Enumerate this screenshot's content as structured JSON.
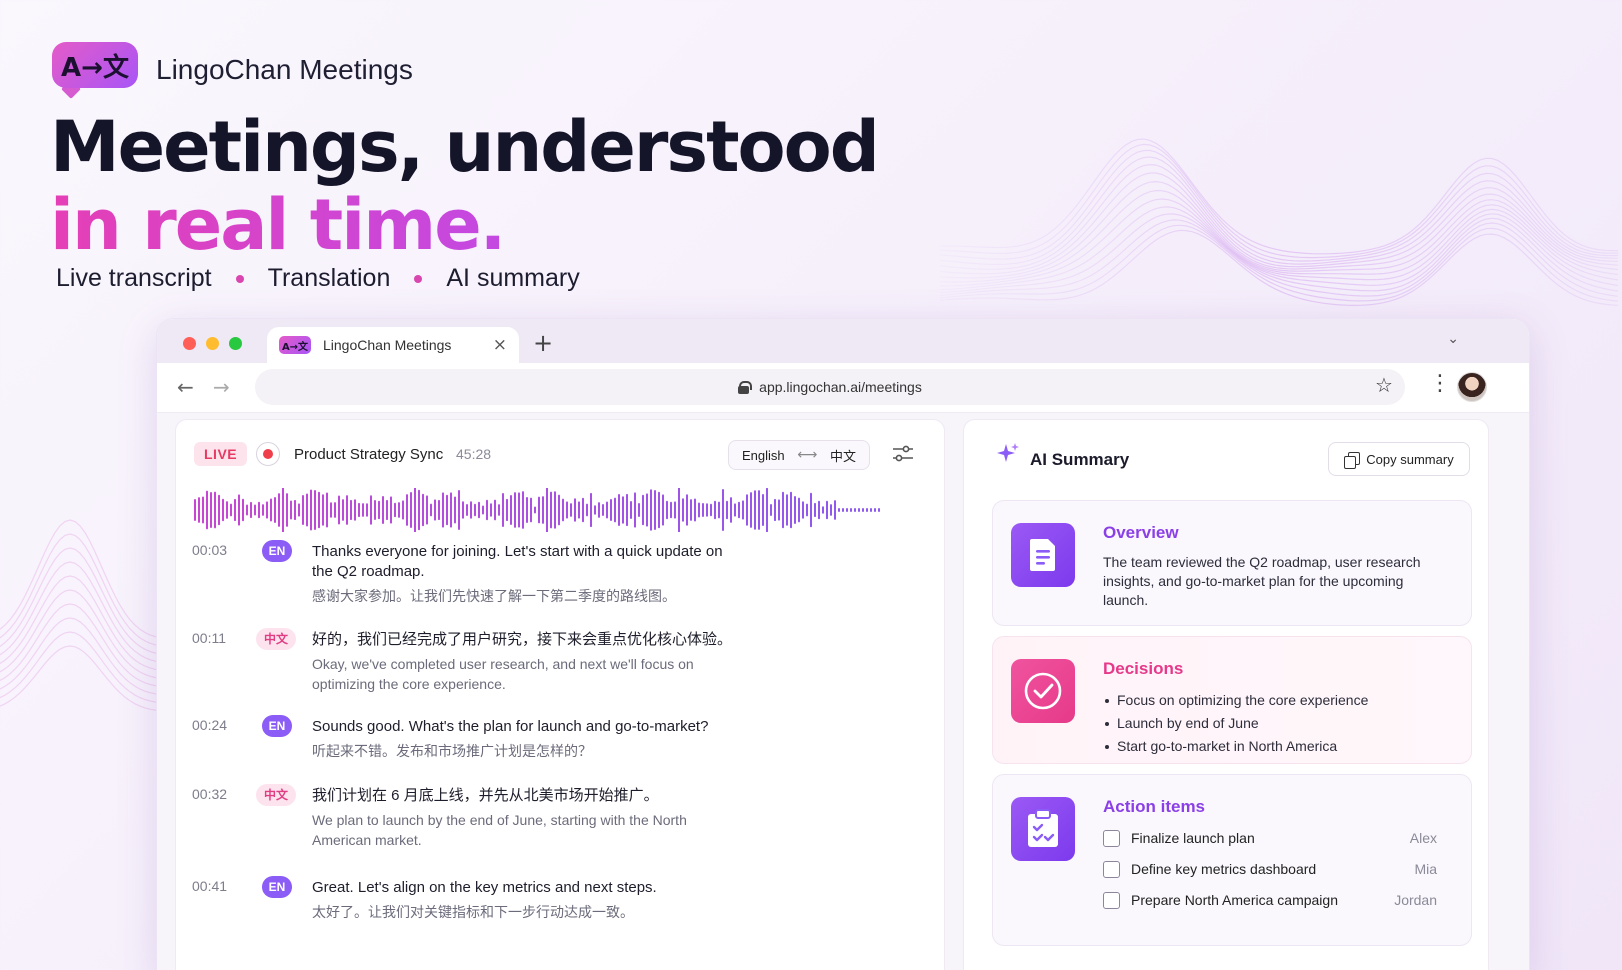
{
  "brand": {
    "logo_text": "A→文",
    "name": "LingoChan Meetings"
  },
  "hero": {
    "line1": "Meetings, understood",
    "line2": "in real time.",
    "features": [
      "Live transcript",
      "Translation",
      "AI summary"
    ]
  },
  "browser": {
    "tab": {
      "logo_text": "A→文",
      "title": "LingoChan Meetings",
      "close": "×",
      "new": "+"
    },
    "url": "app.lingochan.ai/meetings"
  },
  "transcript": {
    "live_label": "LIVE",
    "meeting_title": "Product Strategy Sync",
    "elapsed": "45:28",
    "lang_from": "English",
    "lang_arrow": "⟷",
    "lang_to": "中文",
    "entries": [
      {
        "time": "00:03",
        "lang": "EN",
        "original": "Thanks everyone for joining. Let's start with a quick update on the Q2 roadmap.",
        "translation": "感谢大家参加。让我们先快速了解一下第二季度的路线图。"
      },
      {
        "time": "00:11",
        "lang": "中文",
        "original": "好的，我们已经完成了用户研究，接下来会重点优化核心体验。",
        "translation": "Okay, we've completed user research, and next we'll focus on optimizing the core experience."
      },
      {
        "time": "00:24",
        "lang": "EN",
        "original": "Sounds good. What's the plan for launch and go-to-market?",
        "translation": "听起来不错。发布和市场推广计划是怎样的？"
      },
      {
        "time": "00:32",
        "lang": "中文",
        "original": "我们计划在 6 月底上线，并先从北美市场开始推广。",
        "translation": "We plan to launch by the end of June, starting with the North American market."
      },
      {
        "time": "00:41",
        "lang": "EN",
        "original": "Great. Let's align on the key metrics and next steps.",
        "translation": "太好了。让我们对关键指标和下一步行动达成一致。"
      }
    ]
  },
  "summary": {
    "title": "AI Summary",
    "copy_label": "Copy summary",
    "overview": {
      "title": "Overview",
      "text": "The team reviewed the Q2 roadmap, user research insights, and go-to-market plan for the upcoming launch."
    },
    "decisions": {
      "title": "Decisions",
      "items": [
        "Focus on optimizing the core experience",
        "Launch by end of June",
        "Start go-to-market in North America"
      ]
    },
    "actions": {
      "title": "Action items",
      "items": [
        {
          "label": "Finalize launch plan",
          "owner": "Alex"
        },
        {
          "label": "Define key metrics dashboard",
          "owner": "Mia"
        },
        {
          "label": "Prepare North America campaign",
          "owner": "Jordan"
        }
      ]
    }
  },
  "colors": {
    "accent_purple": "#8b5cf6",
    "accent_pink": "#e6398a",
    "live_red": "#ef3f4b"
  }
}
